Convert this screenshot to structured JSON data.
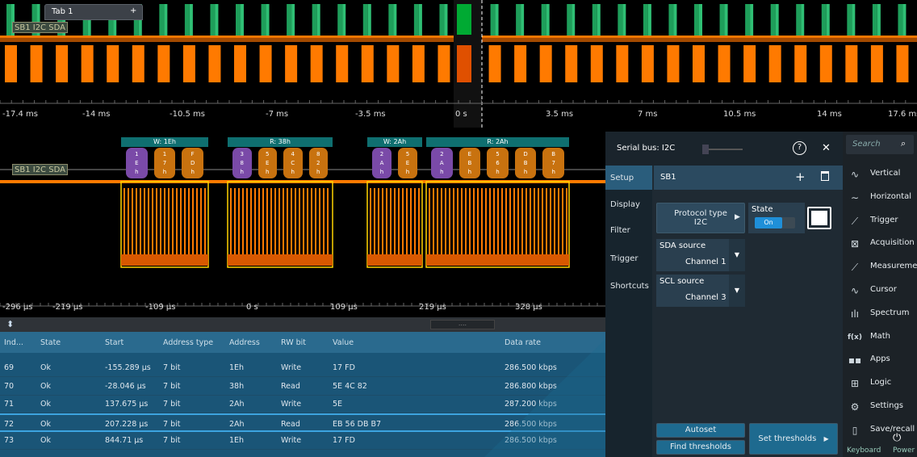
{
  "tab": {
    "label": "Tab 1",
    "add": "+"
  },
  "overview": {
    "signal_label": "SB1 I2C SDA",
    "ticks": [
      "-17.4 ms",
      "-14 ms",
      "-10.5 ms",
      "-7 ms",
      "-3.5 ms",
      "0 s",
      "3.5 ms",
      "7 ms",
      "10.5 ms",
      "14 ms",
      "17.6 ms"
    ]
  },
  "zoom": {
    "signal_label": "SB1 I2C SDA",
    "frames": [
      {
        "label": "W: 1Eh",
        "bytes": [
          [
            "1",
            "E",
            "h"
          ],
          [
            "1",
            "7",
            "h"
          ],
          [
            "F",
            "D",
            "h"
          ]
        ]
      },
      {
        "label": "R: 38h",
        "bytes": [
          [
            "3",
            "8",
            "h"
          ],
          [
            "5",
            "E",
            "h"
          ],
          [
            "4",
            "C",
            "h"
          ],
          [
            "8",
            "2",
            "h"
          ]
        ]
      },
      {
        "label": "W: 2Ah",
        "bytes": [
          [
            "2",
            "A",
            "h"
          ],
          [
            "5",
            "E",
            "h"
          ]
        ]
      },
      {
        "label": "R: 2Ah",
        "bytes": [
          [
            "2",
            "A",
            "h"
          ],
          [
            "E",
            "B",
            "h"
          ],
          [
            "5",
            "6",
            "h"
          ],
          [
            "D",
            "B",
            "h"
          ],
          [
            "B",
            "7",
            "h"
          ]
        ]
      }
    ],
    "ticks": [
      "-296 µs",
      "-219 µs",
      "-109 µs",
      "0 s",
      "109 µs",
      "219 µs",
      "328 µs"
    ]
  },
  "divider": {
    "grip": "....",
    "sort": "⬍"
  },
  "table": {
    "headers": [
      "Ind...",
      "State",
      "Start",
      "Address type",
      "Address",
      "RW bit",
      "Value",
      "Data rate"
    ],
    "rows": [
      [
        "69",
        "Ok",
        "-155.289 µs",
        "7 bit",
        "1Eh",
        "Write",
        "17 FD",
        "286.500 kbps"
      ],
      [
        "70",
        "Ok",
        "-28.046 µs",
        "7 bit",
        "38h",
        "Read",
        "5E 4C 82",
        "286.800 kbps"
      ],
      [
        "71",
        "Ok",
        "137.675 µs",
        "7 bit",
        "2Ah",
        "Write",
        "5E",
        "287.200 kbps"
      ],
      [
        "72",
        "Ok",
        "207.228 µs",
        "7 bit",
        "2Ah",
        "Read",
        "EB 56 DB B7",
        "286.500 kbps"
      ],
      [
        "73",
        "Ok",
        "844.71 µs",
        "7 bit",
        "1Eh",
        "Write",
        "17 FD",
        "286.500 kbps"
      ]
    ],
    "selected_index": 3
  },
  "panel": {
    "title": "Serial bus: I2C",
    "help": "?",
    "close": "✕",
    "nav": [
      "Setup",
      "Display",
      "Filter",
      "Trigger",
      "Shortcuts"
    ],
    "bus_tab": "SB1",
    "add": "+",
    "protocol_label": "Protocol type",
    "protocol_value": "I2C",
    "state_label": "State",
    "state_value": "On",
    "sda_label": "SDA source",
    "sda_value": "Channel 1",
    "scl_label": "SCL source",
    "scl_value": "Channel 3",
    "autoset": "Autoset",
    "find_thresholds": "Find thresholds",
    "set_thresholds": "Set thresholds"
  },
  "menu": {
    "search_placeholder": "Search",
    "items": [
      {
        "label": "Vertical",
        "icon": "vertical-icon"
      },
      {
        "label": "Horizontal",
        "icon": "horizontal-icon"
      },
      {
        "label": "Trigger",
        "icon": "trigger-icon"
      },
      {
        "label": "Acquisition",
        "icon": "acquisition-icon"
      },
      {
        "label": "Measurement",
        "icon": "measurement-icon"
      },
      {
        "label": "Cursor",
        "icon": "cursor-icon"
      },
      {
        "label": "Spectrum",
        "icon": "spectrum-icon"
      },
      {
        "label": "Math",
        "icon": "math-icon"
      },
      {
        "label": "Apps",
        "icon": "apps-icon"
      },
      {
        "label": "Logic",
        "icon": "logic-icon"
      },
      {
        "label": "Settings",
        "icon": "gear-icon"
      },
      {
        "label": "Save/recall",
        "icon": "save-icon"
      }
    ],
    "keyboard": "Keyboard",
    "power": "Power"
  },
  "colors": {
    "signal": "#ff7a00",
    "clock": "#1e9e5a",
    "frame": "#0f6f70",
    "addr": "#7a4aa8",
    "data": "#c8720f",
    "yellow": "#ffd400"
  }
}
